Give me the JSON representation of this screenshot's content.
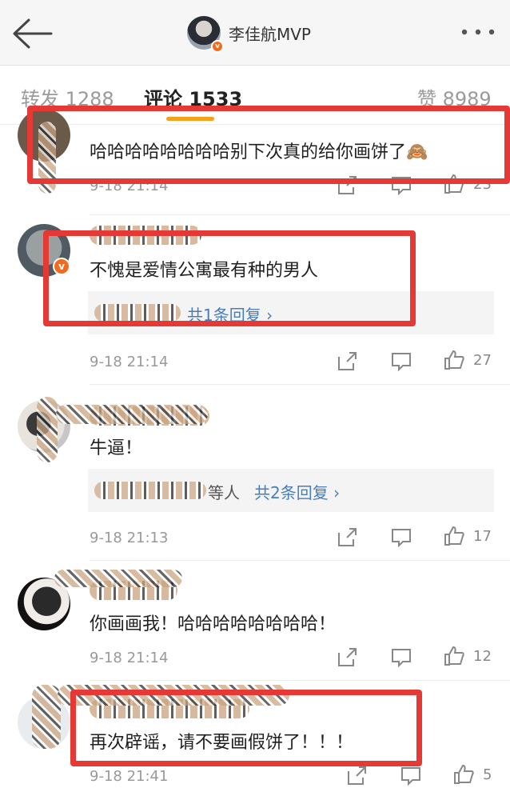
{
  "header": {
    "back_icon": "arrow-left-icon",
    "title": "李佳航MVP",
    "more_icon": "more-horizontal-icon",
    "verified_mark": "v"
  },
  "tabs": [
    {
      "label": "转发 1288",
      "active": false
    },
    {
      "label": "评论 1533",
      "active": true
    },
    {
      "label": "赞 8989",
      "active": false
    }
  ],
  "comments": [
    {
      "text": "哈哈哈哈哈哈哈哈别下次真的给你画饼了🙈",
      "time": "9-18 21:14",
      "likes": "23",
      "reply": null
    },
    {
      "text": "不愧是爱情公寓最有种的男人",
      "time": "9-18 21:14",
      "likes": "27",
      "reply": {
        "text": "共1条回复 ›"
      }
    },
    {
      "text": "牛逼！",
      "time": "9-18 21:13",
      "likes": "17",
      "reply": {
        "suffix": "等人",
        "text": "共2条回复 ›"
      }
    },
    {
      "text": "你画画我！哈哈哈哈哈哈哈哈！",
      "time": "9-18 21:14",
      "likes": "12",
      "reply": null
    },
    {
      "text": "再次辟谣，请不要画假饼了！！！",
      "time": "9-18 21:41",
      "likes": "5",
      "reply": null
    }
  ],
  "colors": {
    "highlight": "#e53935",
    "tab_underline": "#f5a21a",
    "link": "#4a7db8",
    "verified": "#f26b1d"
  }
}
